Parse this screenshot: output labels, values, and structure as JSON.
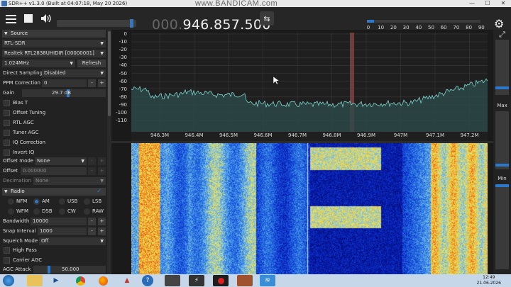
{
  "window": {
    "title": "SDR++ v1.3.0 (Built at 04:07:18, May 20 2026)",
    "watermark": "www.BANDICAM.com",
    "controls": [
      "—",
      "☐",
      "✕"
    ]
  },
  "toolbar": {
    "freq_dim": "000.",
    "freq_main": "946.857.500",
    "swap_icon": "⇆",
    "volume_level": 0.96,
    "snr_level": 0.06,
    "snr_ticks": [
      "0",
      "10",
      "20",
      "30",
      "40",
      "50",
      "60",
      "70",
      "80",
      "90"
    ],
    "settings_icon": "⚙"
  },
  "sidebar": {
    "source": {
      "header": "Source",
      "type": "RTL-SDR",
      "device": "Realtek RTL2838UHIDIR [00000001]",
      "samplerate": "1.024MHz",
      "refresh": "Refresh",
      "direct_sampling_label": "Direct Sampling",
      "direct_sampling_value": "Disabled",
      "ppm_label": "PPM Correction",
      "ppm_value": "0",
      "gain_label": "Gain",
      "gain_value": "29.7 dB",
      "gain_level": 0.55,
      "checkboxes": [
        "Bias T",
        "Offset Tuning",
        "RTL AGC",
        "Tuner AGC",
        "IQ Correction",
        "Invert IQ"
      ],
      "offset_mode_label": "Offset mode",
      "offset_mode_value": "None",
      "offset_label": "Offset",
      "offset_value": "0.000000",
      "decimation_label": "Decimation",
      "decimation_value": "None",
      "minus": "-",
      "plus": "+"
    },
    "radio": {
      "header": "Radio",
      "modes": [
        "NFM",
        "AM",
        "USB",
        "LSB",
        "WFM",
        "DSB",
        "CW",
        "RAW"
      ],
      "selected_mode": "AM",
      "bandwidth_label": "Bandwidth",
      "bandwidth_value": "10000",
      "snap_label": "Snap Interval",
      "snap_value": "1000",
      "squelch_label": "Squelch Mode",
      "squelch_value": "Off",
      "high_pass": "High Pass",
      "carrier_agc": "Carrier AGC",
      "agc_attack_label": "AGC Attack",
      "agc_attack_value": "50.000"
    }
  },
  "fft": {
    "y_ticks": [
      "0",
      "-10",
      "-20",
      "-30",
      "-40",
      "-50",
      "-60",
      "-70",
      "-80",
      "-90",
      "-100",
      "-110"
    ],
    "x_ticks": [
      "946.3M",
      "946.4M",
      "946.5M",
      "946.6M",
      "946.7M",
      "946.8M",
      "946.9M",
      "947M",
      "947.1M",
      "947.2M"
    ]
  },
  "right_panel": {
    "zoom_icon": "⤢",
    "max_label": "Max",
    "min_label": "Min"
  },
  "taskbar": {
    "time": "12:49",
    "date": "21.06.2026"
  }
}
